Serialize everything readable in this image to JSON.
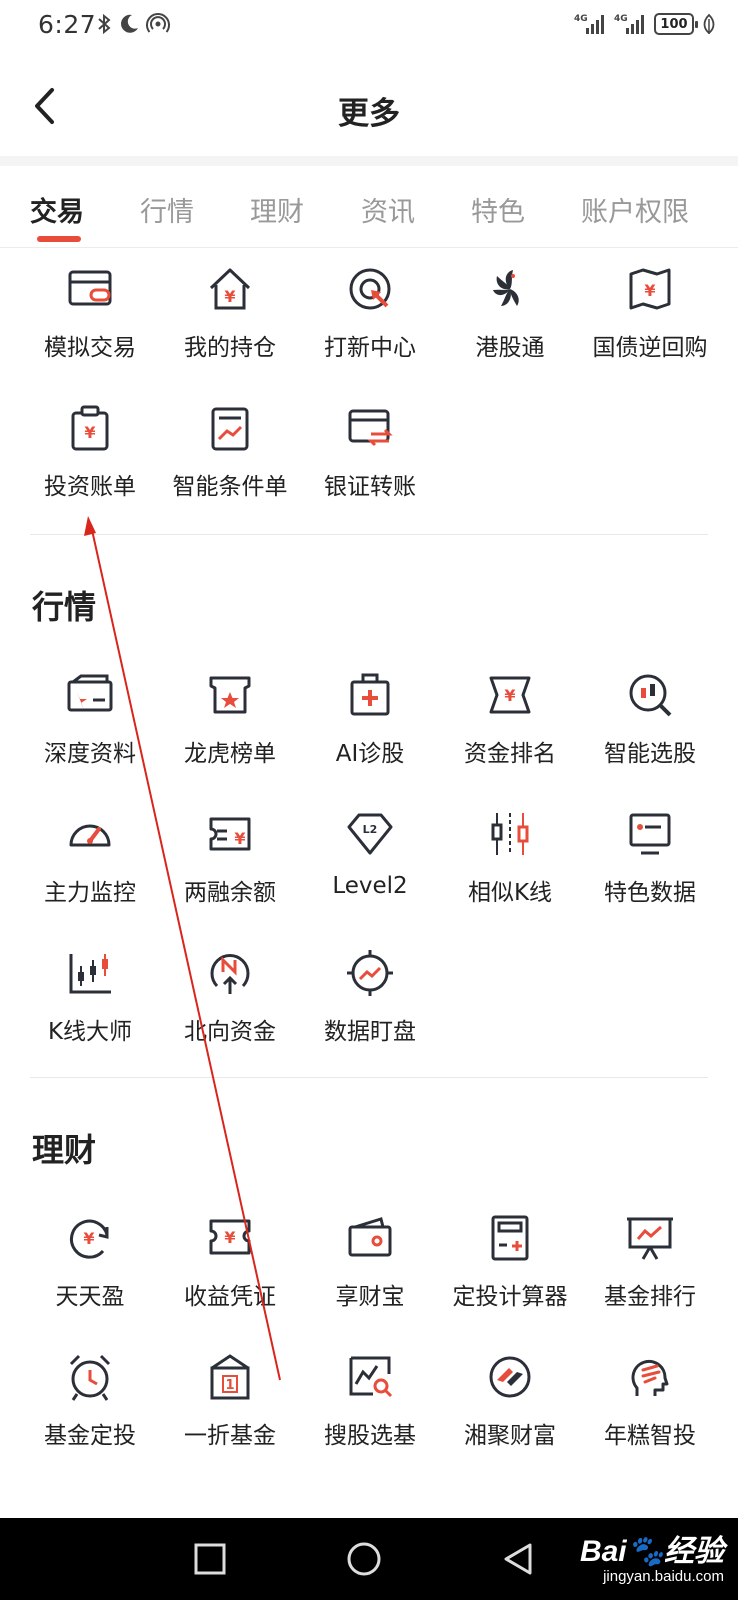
{
  "status_bar": {
    "time": "6:27",
    "signal1": "4G",
    "signal2": "4G",
    "battery": "100"
  },
  "header": {
    "title": "更多",
    "back_icon": "chevron-left-icon"
  },
  "tabs": [
    {
      "label": "交易",
      "active": true
    },
    {
      "label": "行情",
      "active": false
    },
    {
      "label": "理财",
      "active": false
    },
    {
      "label": "资讯",
      "active": false
    },
    {
      "label": "特色",
      "active": false
    },
    {
      "label": "账户权限",
      "active": false
    }
  ],
  "sections": [
    {
      "title": "",
      "items": [
        {
          "label": "模拟交易",
          "icon": "simulated-trade-icon"
        },
        {
          "label": "我的持仓",
          "icon": "holdings-house-icon"
        },
        {
          "label": "打新中心",
          "icon": "ipo-target-icon"
        },
        {
          "label": "港股通",
          "icon": "bauhinia-icon"
        },
        {
          "label": "国债逆回购",
          "icon": "treasury-repo-icon"
        },
        {
          "label": "投资账单",
          "icon": "investment-bill-icon"
        },
        {
          "label": "智能条件单",
          "icon": "smart-order-icon"
        },
        {
          "label": "银证转账",
          "icon": "bank-transfer-icon"
        }
      ]
    },
    {
      "title": "行情",
      "items": [
        {
          "label": "深度资料",
          "icon": "deep-data-icon"
        },
        {
          "label": "龙虎榜单",
          "icon": "dragon-tiger-list-icon"
        },
        {
          "label": "AI诊股",
          "icon": "ai-diagnosis-icon"
        },
        {
          "label": "资金排名",
          "icon": "fund-ranking-icon"
        },
        {
          "label": "智能选股",
          "icon": "smart-picking-icon"
        },
        {
          "label": "主力监控",
          "icon": "gauge-icon"
        },
        {
          "label": "两融余额",
          "icon": "margin-balance-icon"
        },
        {
          "label": "Level2",
          "icon": "level2-diamond-icon"
        },
        {
          "label": "相似K线",
          "icon": "candlestick-icon"
        },
        {
          "label": "特色数据",
          "icon": "monitor-icon"
        },
        {
          "label": "K线大师",
          "icon": "kline-chart-icon"
        },
        {
          "label": "北向资金",
          "icon": "north-compass-icon"
        },
        {
          "label": "数据盯盘",
          "icon": "crosshair-trend-icon"
        }
      ]
    },
    {
      "title": "理财",
      "items": [
        {
          "label": "天天盈",
          "icon": "daily-yield-icon"
        },
        {
          "label": "收益凭证",
          "icon": "ticket-icon"
        },
        {
          "label": "享财宝",
          "icon": "wallet-icon"
        },
        {
          "label": "定投计算器",
          "icon": "calculator-icon"
        },
        {
          "label": "基金排行",
          "icon": "board-chart-icon"
        },
        {
          "label": "基金定投",
          "icon": "alarm-clock-icon"
        },
        {
          "label": "一折基金",
          "icon": "discount-tag-icon"
        },
        {
          "label": "搜股选基",
          "icon": "search-chart-icon"
        },
        {
          "label": "湘聚财富",
          "icon": "circle-logo-icon"
        },
        {
          "label": "年糕智投",
          "icon": "head-brain-icon"
        }
      ]
    }
  ],
  "nav": {
    "recent": "square-icon",
    "home": "circle-icon",
    "back": "triangle-back-icon"
  },
  "watermark": {
    "main": "Bai🐾经验",
    "sub": "jingyan.baidu.com"
  },
  "colors": {
    "accent": "#e84d3c",
    "icon_dark": "#2b2f38",
    "annotation_arrow": "#d9251c"
  }
}
